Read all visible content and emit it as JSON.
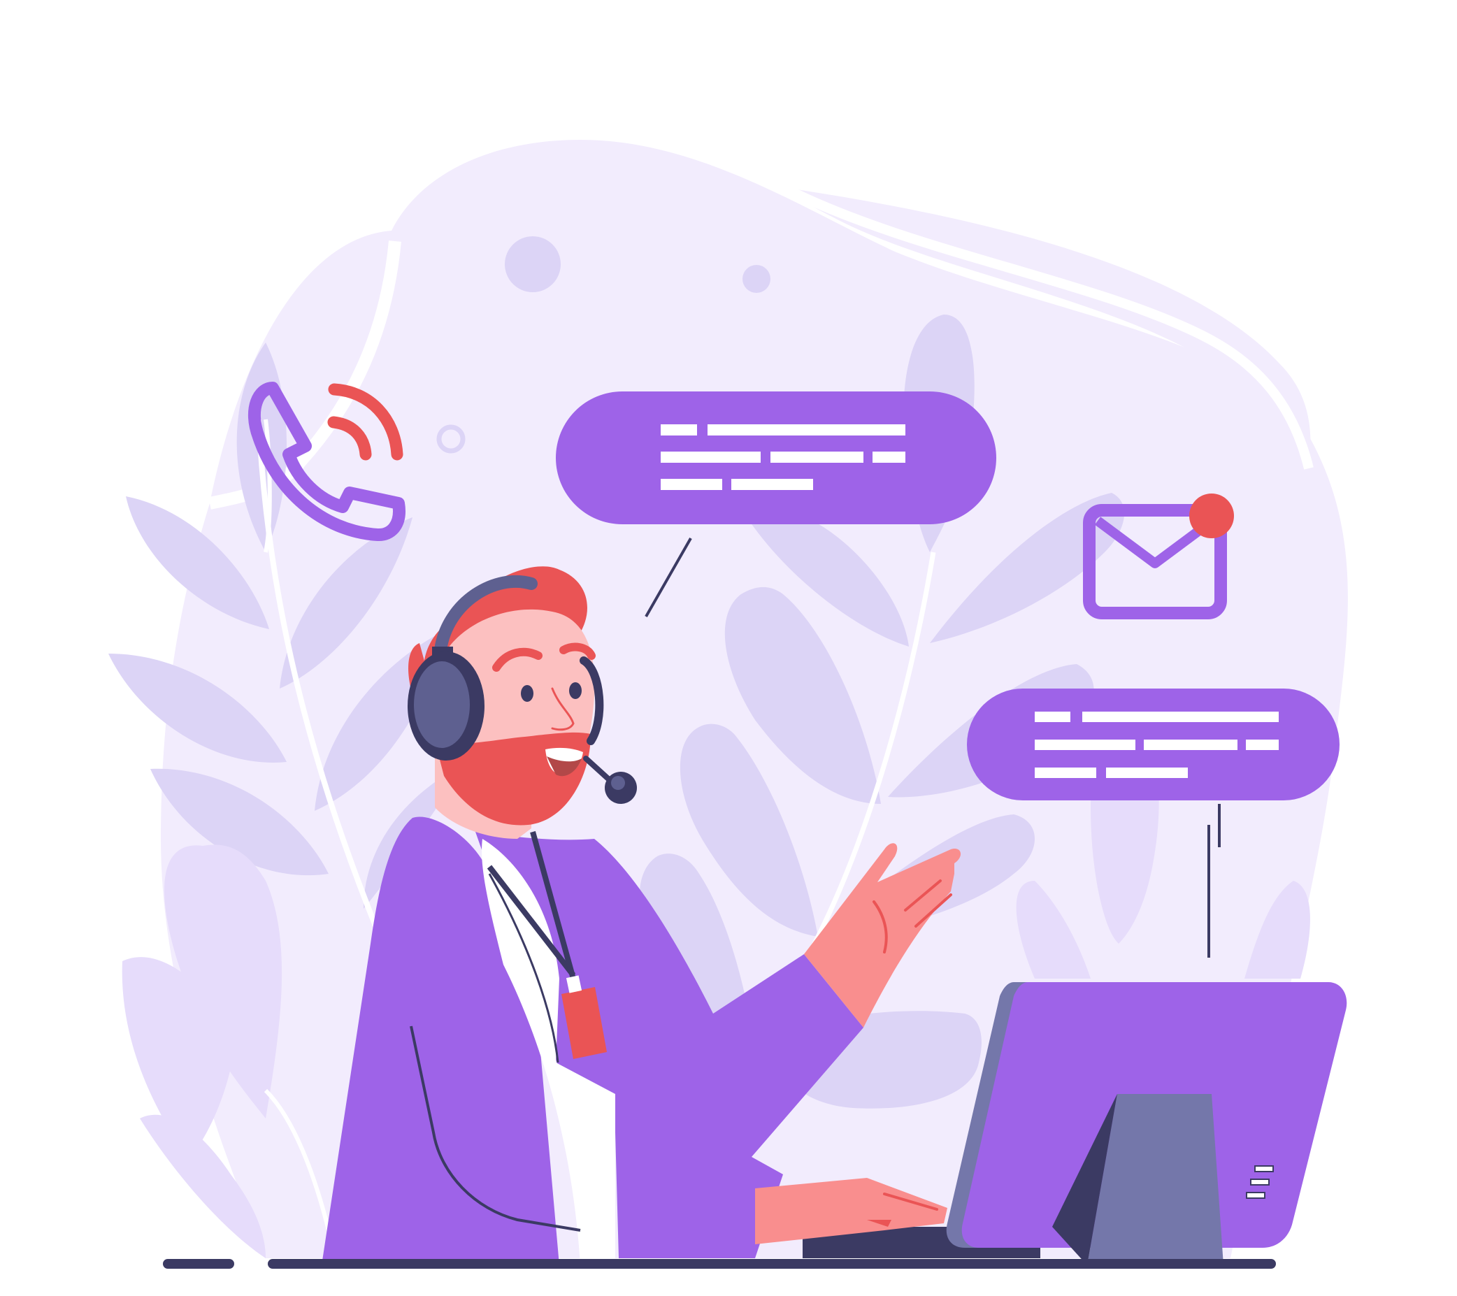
{
  "illustration": {
    "subject": "customer-support-agent-with-headset",
    "icons": [
      "phone-call-icon",
      "mail-notification-icon",
      "chat-bubble-icon",
      "chat-bubble-icon",
      "computer-monitor-icon"
    ],
    "palette": {
      "background": "#ffffff",
      "blob": "#f2ecfd",
      "leaf": "#dcd4f6",
      "leaf_light": "#e6dcfb",
      "accent_purple": "#9e63e8",
      "accent_red": "#ea5455",
      "skin": "#fcc0c0",
      "hand": "#f98e8e",
      "navy": "#3b3a63",
      "headset": "#5e6090",
      "monitor_side": "#7477aa"
    }
  }
}
